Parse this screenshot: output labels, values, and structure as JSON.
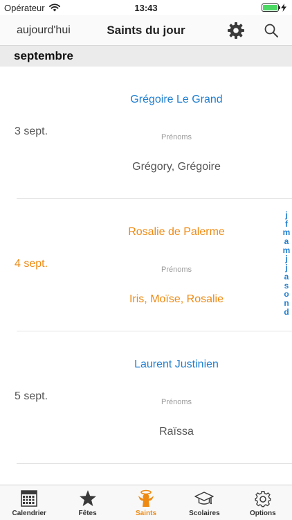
{
  "status": {
    "carrier": "Opérateur",
    "time": "13:43"
  },
  "nav": {
    "left_label": "aujourd'hui",
    "title": "Saints du jour"
  },
  "section": {
    "title": "septembre"
  },
  "rows": [
    {
      "date": "3 sept.",
      "saint": "Grégoire Le Grand",
      "label": "Prénoms",
      "names": "Grégory, Grégoire"
    },
    {
      "date": "4 sept.",
      "saint": "Rosalie de Palerme",
      "label": "Prénoms",
      "names": "Iris, Moïse, Rosalie"
    },
    {
      "date": "5 sept.",
      "saint": "Laurent Justinien",
      "label": "Prénoms",
      "names": "Raïssa"
    }
  ],
  "index": [
    "j",
    "f",
    "m",
    "a",
    "m",
    "j",
    "j",
    "a",
    "s",
    "o",
    "n",
    "d"
  ],
  "tabs": [
    {
      "label": "Calendrier",
      "icon": "calendar-icon"
    },
    {
      "label": "Fêtes",
      "icon": "star-icon"
    },
    {
      "label": "Saints",
      "icon": "saint-icon"
    },
    {
      "label": "Scolaires",
      "icon": "graduation-cap-icon"
    },
    {
      "label": "Options",
      "icon": "gear-icon"
    }
  ],
  "colors": {
    "accent": "#1f7fd0",
    "highlight": "#ee8a12",
    "battery": "#4cd964"
  }
}
